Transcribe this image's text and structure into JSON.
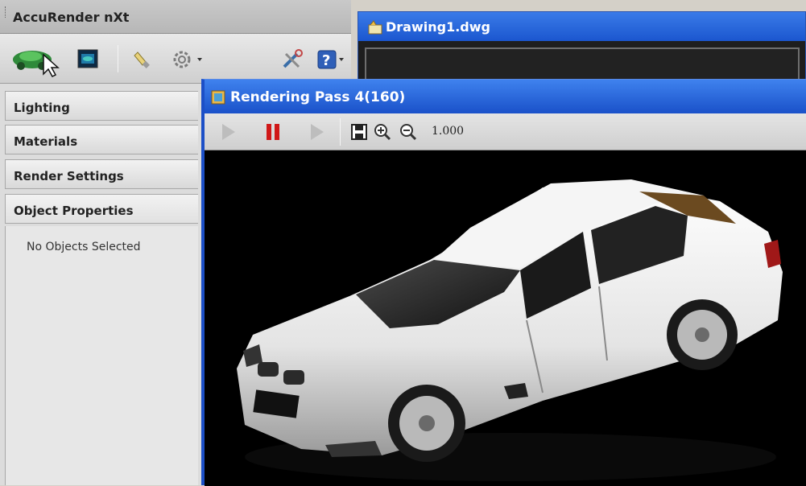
{
  "accurender": {
    "title": "AccuRender nXt",
    "toolbar": {
      "items": [
        "render-pointer-icon",
        "render-view-icon",
        "light-bulb-icon",
        "gear-icon",
        "tools-icon",
        "help-icon"
      ]
    },
    "sections": [
      "Lighting",
      "Materials",
      "Render Settings",
      "Object Properties"
    ],
    "object_properties_message": "No Objects Selected"
  },
  "drawing_window": {
    "title": "Drawing1.dwg"
  },
  "render_window": {
    "title": "Rendering Pass 4(160)",
    "zoom_level": "1.000",
    "toolbar_icons": [
      "play-icon",
      "pause-icon",
      "step-icon",
      "save-icon",
      "zoom-in-icon",
      "zoom-out-icon"
    ],
    "subject": "white sedan car render"
  },
  "colors": {
    "titlebar_blue": "#1b56cf",
    "pause_red": "#d01818",
    "panel_grey": "#dcdcdc"
  }
}
